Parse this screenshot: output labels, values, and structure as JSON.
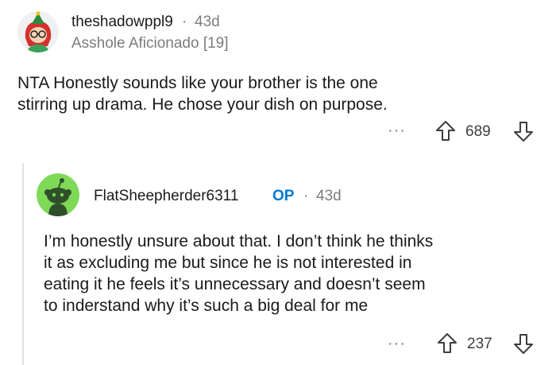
{
  "comments": [
    {
      "username": "theshadowppl9",
      "separator": "·",
      "age": "43d",
      "flair": "Asshole Aficionado [19]",
      "body_lines": [
        "NTA Honestly sounds like your brother is the one",
        "stirring up drama. He chose your dish on purpose."
      ],
      "votes": "689",
      "more_label": "···",
      "avatar_icon": "snoo-avatar-red-hair-icon"
    },
    {
      "username": "FlatSheepherder6311",
      "op_badge": "OP",
      "separator": "·",
      "age": "43d",
      "body_lines": [
        "I’m honestly unsure about that. I don’t think he thinks",
        "it as excluding me but since he is not interested in",
        "eating it he feels it’s unnecessary and doesn’t seem",
        "to inderstand why it’s such a big deal for me"
      ],
      "votes": "237",
      "more_label": "···",
      "avatar_icon": "snoo-avatar-green-icon"
    }
  ],
  "colors": {
    "op_badge": "#0079d3",
    "green_avatar": "#7ed957"
  }
}
